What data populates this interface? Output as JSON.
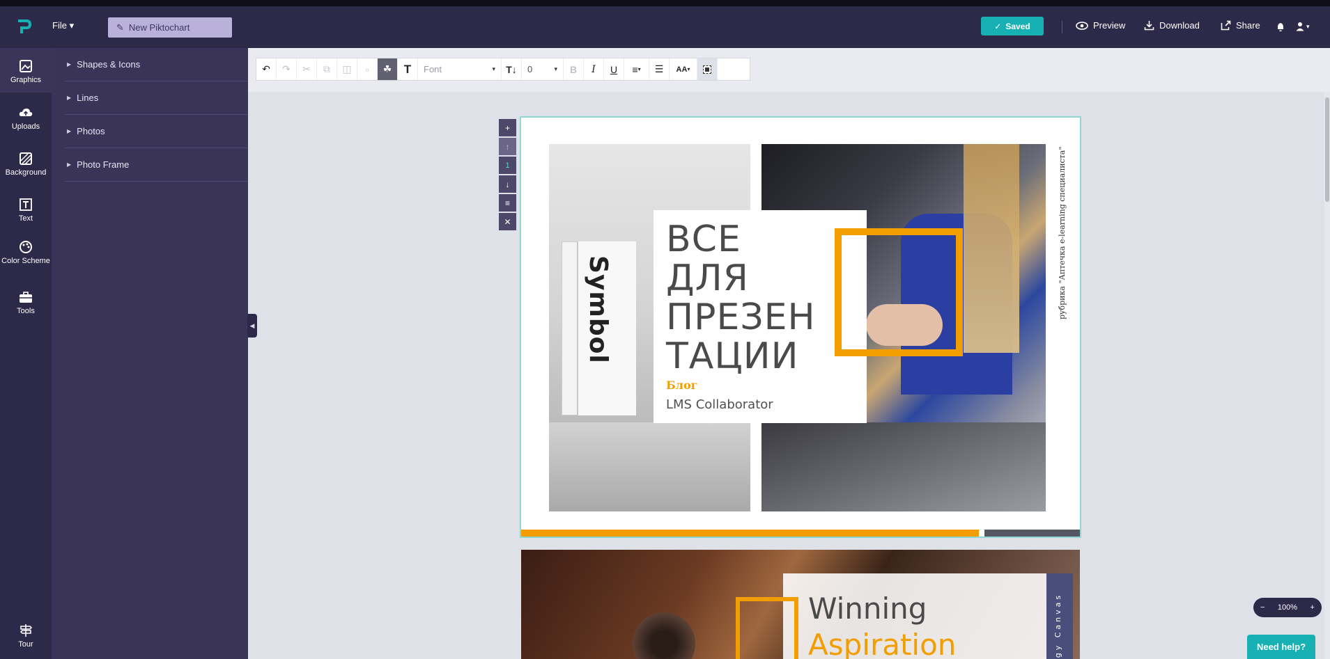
{
  "app": {
    "file_label": "File",
    "title": "New Piktochart",
    "saved_label": "Saved",
    "actions": {
      "preview": "Preview",
      "download": "Download",
      "share": "Share"
    }
  },
  "rail": {
    "items": [
      {
        "label": "Graphics",
        "icon": "image-icon"
      },
      {
        "label": "Uploads",
        "icon": "cloud-upload-icon"
      },
      {
        "label": "Background",
        "icon": "background-icon"
      },
      {
        "label": "Text",
        "icon": "text-icon"
      },
      {
        "label": "Color Scheme",
        "icon": "palette-icon"
      },
      {
        "label": "Tools",
        "icon": "toolbox-icon"
      },
      {
        "label": "Tour",
        "icon": "signpost-icon"
      }
    ]
  },
  "panel": {
    "items": [
      {
        "label": "Shapes & Icons"
      },
      {
        "label": "Lines"
      },
      {
        "label": "Photos"
      },
      {
        "label": "Photo Frame"
      }
    ]
  },
  "toolbar": {
    "font_label": "Font",
    "size_value": "0"
  },
  "block_controls": {
    "block_number": "1"
  },
  "canvas": {
    "block1": {
      "book_text": "Symbol",
      "title": "ВСЕ\nДЛЯ\nПРЕЗЕН\nТАЦИИ",
      "blog": "Блог",
      "subtitle": "LMS Collaborator",
      "vertical_caption": "рубрика \"Аптечка e-learning специалиста\""
    },
    "block2": {
      "line1": "Winning",
      "line2": "Aspiration",
      "strip": "egy Canvas"
    }
  },
  "zoom": {
    "value": "100%",
    "minus": "−",
    "plus": "+"
  },
  "help": {
    "label": "Need help?"
  },
  "colors": {
    "accent": "#17b1b3",
    "brand_orange": "#f29d00",
    "sidebar": "#2d2948"
  }
}
